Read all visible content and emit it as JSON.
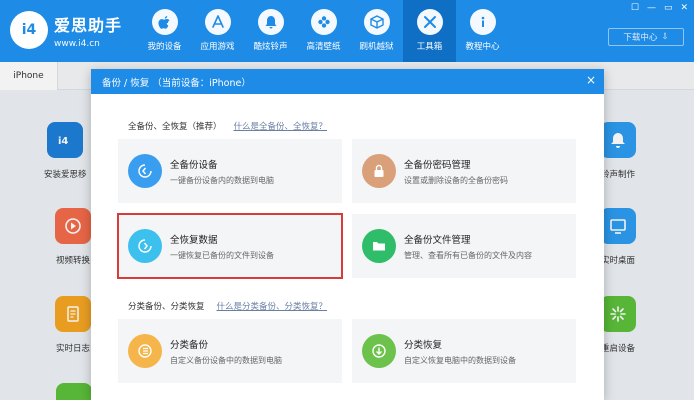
{
  "app": {
    "name": "爱思助手",
    "url": "www.i4.cn",
    "logo_text": "i4"
  },
  "nav": [
    {
      "label": "我的设备",
      "icon": "apple-icon"
    },
    {
      "label": "应用游戏",
      "icon": "appstore-icon"
    },
    {
      "label": "酷炫铃声",
      "icon": "bell-icon"
    },
    {
      "label": "高清壁纸",
      "icon": "flower-icon"
    },
    {
      "label": "刷机越狱",
      "icon": "box-icon"
    },
    {
      "label": "工具箱",
      "icon": "tools-icon",
      "active": true
    },
    {
      "label": "教程中心",
      "icon": "info-icon"
    }
  ],
  "window_controls": [
    "☐",
    "—",
    "▭",
    "✕"
  ],
  "download_center": "下载中心",
  "device_tab": "iPhone",
  "background_tiles": [
    {
      "label": "安装爱思移",
      "color": "#1e7fd8",
      "icon": "i4-icon"
    },
    {
      "label": "视频转换",
      "color": "#f36b4a",
      "icon": "play-icon"
    },
    {
      "label": "实时日志",
      "color": "#f5a623",
      "icon": "document-icon"
    },
    {
      "label": "铃声制作",
      "color": "#2d9bf0",
      "icon": "bell-icon"
    },
    {
      "label": "实时桌面",
      "color": "#2d9bf0",
      "icon": "monitor-icon"
    },
    {
      "label": "重启设备",
      "color": "#5cbf3a",
      "icon": "sparkle-icon"
    }
  ],
  "modal": {
    "title": "备份 / 恢复 （当前设备：iPhone）",
    "close": "×",
    "sections": [
      {
        "title": "全备份、全恢复（推荐）",
        "link": "什么是全备份、全恢复？",
        "cards": [
          {
            "title": "全备份设备",
            "desc": "一键备份设备内的数据到电脑",
            "color": "#3a9ef0",
            "icon": "backup-icon"
          },
          {
            "title": "全备份密码管理",
            "desc": "设置或删除设备的全备份密码",
            "color": "#d9a07a",
            "icon": "lock-icon"
          },
          {
            "title": "全恢复数据",
            "desc": "一键恢复已备份的文件到设备",
            "color": "#3cc0ee",
            "icon": "restore-icon"
          },
          {
            "title": "全备份文件管理",
            "desc": "管理、查看所有已备份的文件及内容",
            "color": "#2fbd6a",
            "icon": "folder-icon"
          }
        ]
      },
      {
        "title": "分类备份、分类恢复",
        "link": "什么是分类备份、分类恢复？",
        "cards": [
          {
            "title": "分类备份",
            "desc": "自定义备份设备中的数据到电脑",
            "color": "#f5b54a",
            "icon": "category-backup-icon"
          },
          {
            "title": "分类恢复",
            "desc": "自定义恢复电脑中的数据到设备",
            "color": "#6cc24a",
            "icon": "category-restore-icon"
          }
        ]
      }
    ]
  }
}
